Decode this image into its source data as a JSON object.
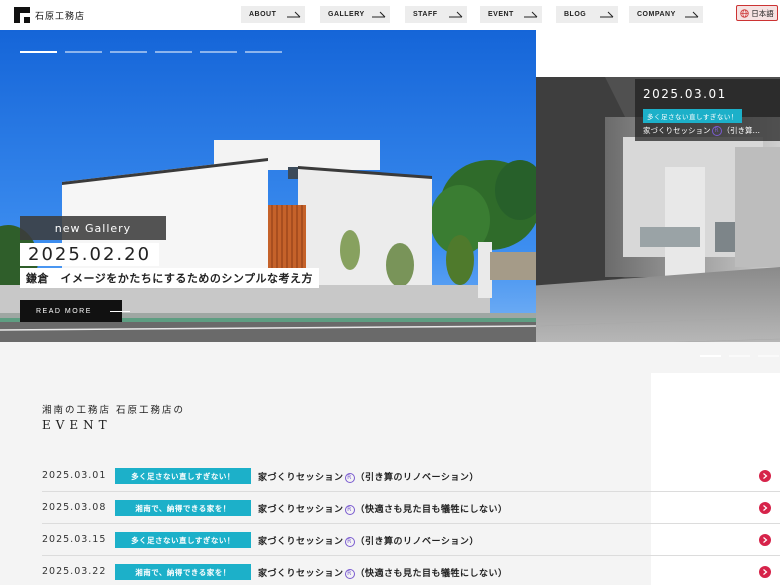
{
  "header": {
    "logo_text": "石原工務店",
    "nav": [
      {
        "label": "ABOUT"
      },
      {
        "label": "GALLERY"
      },
      {
        "label": "STAFF"
      },
      {
        "label": "EVENT"
      },
      {
        "label": "BLOG"
      },
      {
        "label": "COMPANY"
      }
    ],
    "language_label": "日本語"
  },
  "hero": {
    "badge": "new Gallery",
    "date": "2025.02.20",
    "title": "鎌倉　イメージをかたちにするためのシンプルな考え方",
    "read_more": "READ MORE",
    "slide_count": 6,
    "active_slide": 1
  },
  "side_card": {
    "date": "2025.03.01",
    "tag": "多く足さない直しすぎない！",
    "title_prefix": "家づくりセッション",
    "title_suffix": "（引き算…"
  },
  "event_section": {
    "subheading": "湘南の工務店 石原工務店の",
    "heading": "EVENT",
    "registered_mark": "R",
    "items": [
      {
        "date": "2025.03.01",
        "tag": "多く足さない直しすぎない！",
        "title": "家づくりセッション",
        "suffix": "（引き算のリノベーション）"
      },
      {
        "date": "2025.03.08",
        "tag": "湘南で、納得できる家を！",
        "title": "家づくりセッション",
        "suffix": "（快適さも見た目も犠牲にしない）"
      },
      {
        "date": "2025.03.15",
        "tag": "多く足さない直しすぎない！",
        "title": "家づくりセッション",
        "suffix": "（引き算のリノベーション）"
      },
      {
        "date": "2025.03.22",
        "tag": "湘南で、納得できる家を！",
        "title": "家づくりセッション",
        "suffix": "（快適さも見た目も犠牲にしない）"
      }
    ]
  },
  "colors": {
    "accent_teal": "#1cb0c9",
    "arrow_red": "#d6234a",
    "lang_border": "#cc3333"
  }
}
